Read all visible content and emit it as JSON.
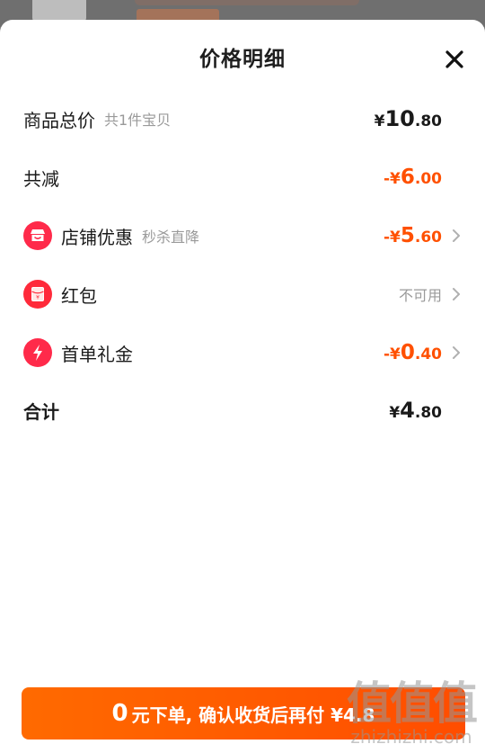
{
  "sheet": {
    "title": "价格明细"
  },
  "rows": {
    "total": {
      "label": "商品总价",
      "sub": "共1件宝贝",
      "sym": "¥",
      "int": "10",
      "dec": ".80"
    },
    "reduce": {
      "label": "共减",
      "sym": "-¥",
      "int": "6",
      "dec": ".00"
    },
    "shop": {
      "label": "店铺优惠",
      "sub": "秒杀直降",
      "sym": "-¥",
      "int": "5",
      "dec": ".60",
      "icon": "shop-icon",
      "color": "#ff2a4a"
    },
    "redpacket": {
      "label": "红包",
      "value": "不可用",
      "icon": "red-envelope-icon",
      "color": "#ff2a3a"
    },
    "firstorder": {
      "label": "首单礼金",
      "sym": "-¥",
      "int": "0",
      "dec": ".40",
      "icon": "lightning-icon",
      "color": "#ff2a4a"
    },
    "sum": {
      "label": "合计",
      "sym": "¥",
      "int": "4",
      "dec": ".80"
    }
  },
  "cta": {
    "big": "0",
    "text": "元下单, 确认收货后再付 ¥4.8"
  },
  "watermark": {
    "logo": "值值值",
    "url": "zhizhizhi.com"
  },
  "colors": {
    "accent": "#ff5000",
    "brand_red": "#ff2a4a"
  }
}
